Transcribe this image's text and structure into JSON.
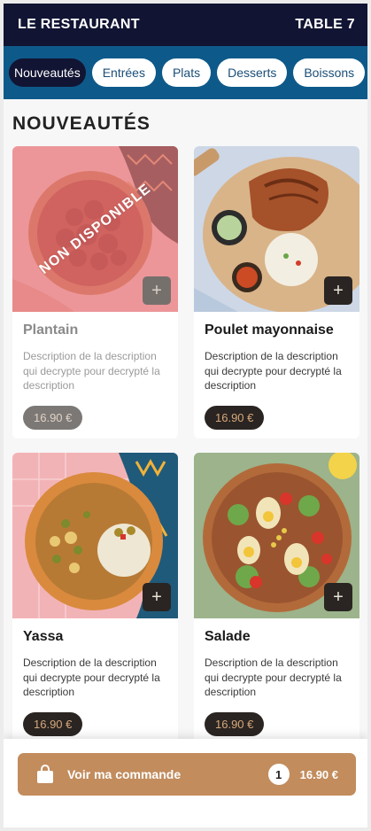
{
  "header": {
    "title": "LE RESTAURANT",
    "table": "TABLE 7"
  },
  "categories": [
    {
      "label": "Nouveautés",
      "active": true
    },
    {
      "label": "Entrées"
    },
    {
      "label": "Plats"
    },
    {
      "label": "Desserts"
    },
    {
      "label": "Boissons"
    }
  ],
  "section": {
    "title": "NOUVEAUTÉS"
  },
  "products": [
    {
      "name": "Plantain",
      "description": "Description de la description qui decrypte pour decrypté la description",
      "price": "16.90 €",
      "available": false,
      "status": "NON DISPONIBLE",
      "add": "+"
    },
    {
      "name": "Poulet mayonnaise",
      "description": "Description de la description qui decrypte pour decrypté la description",
      "price": "16.90 €",
      "available": true,
      "add": "+"
    },
    {
      "name": "Yassa",
      "description": "Description de la description qui decrypte pour decrypté la description",
      "price": "16.90 €",
      "available": true,
      "add": "+"
    },
    {
      "name": "Salade",
      "description": "Description de la description qui decrypte pour decrypté la description",
      "price": "16.90 €",
      "available": true,
      "add": "+"
    }
  ],
  "order": {
    "label": "Voir ma commande",
    "count": "1",
    "total": "16.90 €"
  },
  "colors": {
    "header": "#121433",
    "category_bar": "#0d5a8a",
    "accent": "#c28c5d",
    "price_text": "#d7a77a",
    "dark": "#2a2522"
  },
  "icons": {
    "cart": "shopping-bag-icon",
    "add": "plus-icon"
  }
}
